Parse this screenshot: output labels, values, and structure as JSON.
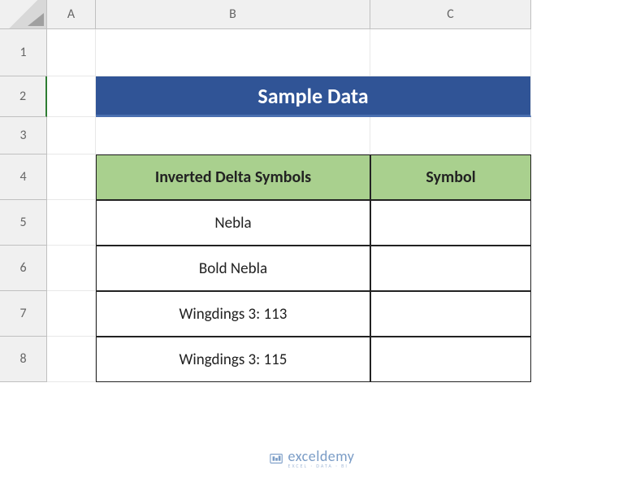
{
  "columns": [
    "A",
    "B",
    "C"
  ],
  "rows": [
    "1",
    "2",
    "3",
    "4",
    "5",
    "6",
    "7",
    "8"
  ],
  "selected_row": "2",
  "banner": {
    "title": "Sample Data"
  },
  "table": {
    "headers": {
      "col1": "Inverted Delta Symbols",
      "col2": "Symbol"
    },
    "rows": [
      {
        "label": "Nebla",
        "symbol": ""
      },
      {
        "label": "Bold Nebla",
        "symbol": ""
      },
      {
        "label": "Wingdings 3: 113",
        "symbol": ""
      },
      {
        "label": "Wingdings 3: 115",
        "symbol": ""
      }
    ]
  },
  "watermark": {
    "brand": "exceldemy",
    "tagline": "EXCEL · DATA · BI"
  }
}
